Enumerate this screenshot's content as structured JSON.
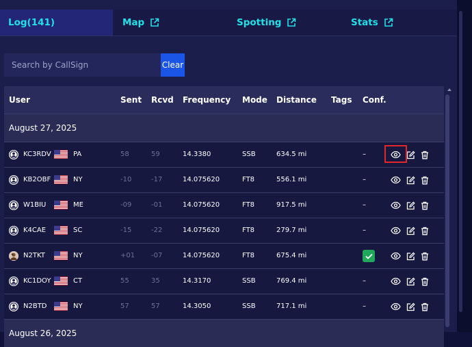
{
  "tabs": [
    {
      "label": "Log(141)",
      "active": true
    },
    {
      "label": "Map",
      "icon": "external-link-icon"
    },
    {
      "label": "Spotting",
      "icon": "external-link-icon"
    },
    {
      "label": "Stats",
      "icon": "external-link-icon"
    }
  ],
  "search": {
    "placeholder": "Search by CallSign",
    "value": "",
    "clear_label": "Clear"
  },
  "columns": [
    "User",
    "Sent",
    "Rcvd",
    "Frequency",
    "Mode",
    "Distance",
    "Tags",
    "Conf."
  ],
  "groups": [
    {
      "date": "August 27, 2025",
      "rows": [
        {
          "callsign": "KC3RDV",
          "state": "PA",
          "sent": "58",
          "rcvd": "59",
          "frequency": "14.3380",
          "mode": "SSB",
          "distance": "634.5 mi",
          "conf": "–",
          "avatar": "user-icon"
        },
        {
          "callsign": "KB2OBF",
          "state": "NY",
          "sent": "-10",
          "rcvd": "-17",
          "frequency": "14.075620",
          "mode": "FT8",
          "distance": "556.1 mi",
          "conf": "–",
          "avatar": "user-icon"
        },
        {
          "callsign": "W1BIU",
          "state": "ME",
          "sent": "-09",
          "rcvd": "-01",
          "frequency": "14.075620",
          "mode": "FT8",
          "distance": "917.5 mi",
          "conf": "–",
          "avatar": "user-icon"
        },
        {
          "callsign": "K4CAE",
          "state": "SC",
          "sent": "-15",
          "rcvd": "-22",
          "frequency": "14.075620",
          "mode": "FT8",
          "distance": "279.7 mi",
          "conf": "–",
          "avatar": "user-icon"
        },
        {
          "callsign": "N2TKT",
          "state": "NY",
          "sent": "+01",
          "rcvd": "-07",
          "frequency": "14.075620",
          "mode": "FT8",
          "distance": "675.4 mi",
          "conf": "check",
          "avatar": "photo-avatar"
        },
        {
          "callsign": "KC1DOY",
          "state": "CT",
          "sent": "55",
          "rcvd": "35",
          "frequency": "14.3170",
          "mode": "SSB",
          "distance": "769.4 mi",
          "conf": "–",
          "avatar": "user-icon"
        },
        {
          "callsign": "N2BTD",
          "state": "NY",
          "sent": "57",
          "rcvd": "57",
          "frequency": "14.3050",
          "mode": "SSB",
          "distance": "717.1 mi",
          "conf": "–",
          "avatar": "user-icon"
        }
      ]
    },
    {
      "date": "August 26, 2025",
      "rows": []
    }
  ],
  "flag_icon": "us-flag-icon",
  "row_actions": [
    "eye-icon",
    "edit-icon",
    "trash-icon"
  ],
  "colors": {
    "accent": "#21e0e8",
    "clear_button": "#1a55e8",
    "confirmed": "#21a85b",
    "highlight": "#e3262a"
  }
}
